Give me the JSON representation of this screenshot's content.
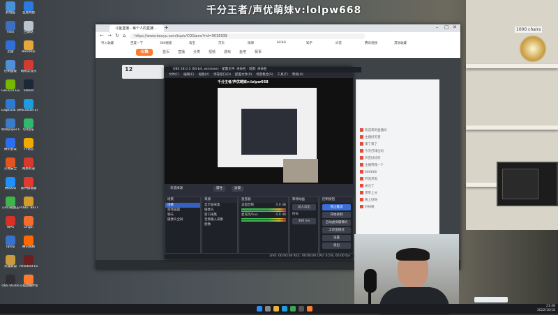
{
  "overlay": {
    "watermark": "千分王者/声优萌妹v:lolpw668"
  },
  "desktop": {
    "icons": [
      {
        "label": "此电脑",
        "color": "#4a90d9"
      },
      {
        "label": "百度网盘",
        "color": "#2a7ae2"
      },
      {
        "label": "Visio",
        "color": "#3c6fbf"
      },
      {
        "label": "回收站",
        "color": "#b9c4cf"
      },
      {
        "label": "迅雷",
        "color": "#2f6fda"
      },
      {
        "label": "Bandizip",
        "color": "#e7a83a"
      },
      {
        "label": "控制面板",
        "color": "#4f8fd8"
      },
      {
        "label": "网易云音乐",
        "color": "#d33a31"
      },
      {
        "label": "GeForce Experience",
        "color": "#76b900"
      },
      {
        "label": "Steam",
        "color": "#1b2838"
      },
      {
        "label": "EdgeLink 浏览器",
        "color": "#2e7ad1"
      },
      {
        "label": "Microsoft Edge",
        "color": "#1f9be0"
      },
      {
        "label": "Wallpaper Engine",
        "color": "#3a7cc7"
      },
      {
        "label": "QQ音乐",
        "color": "#30b86b"
      },
      {
        "label": "腾讯会议",
        "color": "#2a6ff0"
      },
      {
        "label": "YY语音",
        "color": "#f2a900"
      },
      {
        "label": "火绒安全",
        "color": "#e2541f"
      },
      {
        "label": "网易有道",
        "color": "#d8392b"
      },
      {
        "label": "腾讯QQ",
        "color": "#1e90ff"
      },
      {
        "label": "雷神加速器",
        "color": "#e23b2e"
      },
      {
        "label": "2345看图王",
        "color": "#3db54a"
      },
      {
        "label": "PUBG: BATTLEGR...",
        "color": "#d29b2a"
      },
      {
        "label": "WPS",
        "color": "#d93025"
      },
      {
        "label": "Origin",
        "color": "#f56c2d"
      },
      {
        "label": "Uplay",
        "color": "#3a72c9"
      },
      {
        "label": "腾讯视频",
        "color": "#ff6a00"
      },
      {
        "label": "英雄联盟",
        "color": "#c89b3c"
      },
      {
        "label": "Resident Evil 7",
        "color": "#6b1f1f"
      },
      {
        "label": "OBS Studio",
        "color": "#302e31"
      },
      {
        "label": "斗鱼直播伴侣",
        "color": "#ff7a2e"
      }
    ]
  },
  "browser": {
    "tab_title": "斗鱼直播 - 每个人的直播...",
    "url": "https://www.douyu.com/topic/COGame?rid=9016939",
    "bookmarks": [
      "导入收藏",
      "百度一下",
      "360搜索",
      "淘宝",
      "京东",
      "微博",
      "bilibili",
      "知乎",
      "抖音",
      "腾讯视频",
      "其他收藏"
    ],
    "site_logo": "斗鱼",
    "site_nav": [
      "首页",
      "直播",
      "分类",
      "视频",
      "游戏",
      "鱼吧",
      "赛事"
    ],
    "room_number": "12",
    "chat_lines": [
      "欢迎来到直播间",
      "主播好厉害",
      "来了来了",
      "今天打排位吗",
      "声音好好听",
      "主播带我一个",
      "666666",
      "开黑开黑",
      "关注了",
      "求带上分",
      "晚上好呀",
      "好帅啊"
    ]
  },
  "obs": {
    "title": "OBS 28.0.3 (64-bit, windows) - 配置文件: 未命名 - 场景: 未命名",
    "menu": [
      "文件(F)",
      "编辑(E)",
      "视图(V)",
      "停靠窗口(D)",
      "配置文件(P)",
      "场景集合(S)",
      "工具(T)",
      "帮助(H)"
    ],
    "inner_watermark": "千分王者/声优萌妹v:lolpw668",
    "controls": {
      "no_source": "未选择源",
      "properties": "属性",
      "filters": "滤镜"
    },
    "docks": {
      "scenes": {
        "title": "场景",
        "items": [
          "场景",
          "游戏画面",
          "聊天",
          "摄像头全屏"
        ],
        "selected": 0
      },
      "sources": {
        "title": "来源",
        "items": [
          "显示器采集",
          "摄像头",
          "窗口采集",
          "音频输入采集",
          "图像"
        ]
      },
      "mixer": {
        "title": "混音器",
        "channels": [
          {
            "name": "桌面音频",
            "db": "0.0 dB"
          },
          {
            "name": "麦克风/Aux",
            "db": "0.0 dB"
          }
        ]
      },
      "transitions": {
        "title": "转场动画",
        "type": "淡入淡出",
        "duration_label": "时长",
        "duration": "300 ms"
      },
      "controls": {
        "title": "控制按钮",
        "buttons": [
          "停止推流",
          "开始录制",
          "启动虚拟摄像机",
          "工作室模式",
          "设置",
          "退出"
        ],
        "active": 0
      }
    },
    "status": "LIVE: 00:00:00  REC: 00:00:00  CPU: 0.5%, 60.00 fps"
  },
  "taskbar": {
    "time": "21:48",
    "date": "2022/10/18",
    "apps": [
      {
        "name": "windows-start-icon",
        "color": "#2d8cf0"
      },
      {
        "name": "search-icon",
        "color": "#888888"
      },
      {
        "name": "file-explorer-icon",
        "color": "#e7b43c"
      },
      {
        "name": "edge-icon",
        "color": "#1f9be0"
      },
      {
        "name": "chrome-icon",
        "color": "#34a853"
      },
      {
        "name": "obs-icon",
        "color": "#555555"
      },
      {
        "name": "douyu-icon",
        "color": "#ff7a2e"
      }
    ]
  }
}
